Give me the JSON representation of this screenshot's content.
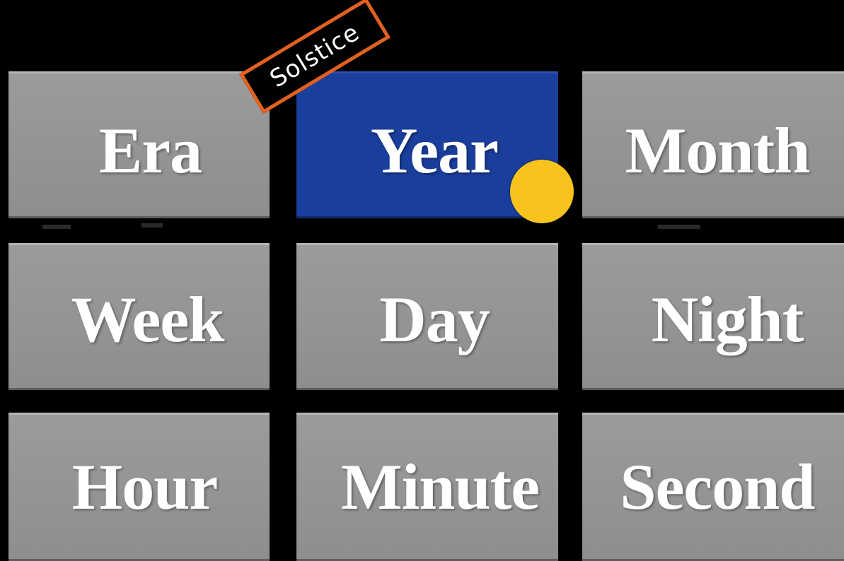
{
  "tiles": {
    "era": "Era",
    "year": "Year",
    "month": "Month",
    "week": "Week",
    "day": "Day",
    "night": "Night",
    "hour": "Hour",
    "minute": "Minute",
    "second": "Second"
  },
  "selected_tile": "Year",
  "badge": {
    "label": "Solstice"
  },
  "colors": {
    "background": "#000000",
    "tile": "#959595",
    "selected_tile": "#1a3e9c",
    "badge_border": "#e3611f",
    "marker_dot": "#f8c31d",
    "text": "#ffffff"
  }
}
